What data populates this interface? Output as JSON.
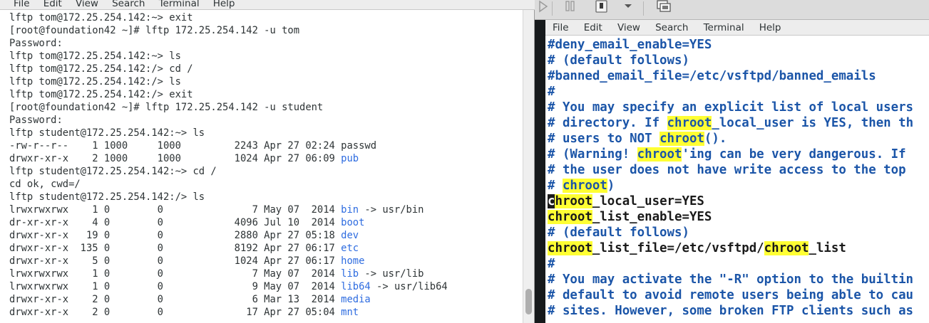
{
  "left_terminal": {
    "menu": [
      "File",
      "Edit",
      "View",
      "Search",
      "Terminal",
      "Help"
    ],
    "lines": [
      {
        "text": "lftp tom@172.25.254.142:~> exit"
      },
      {
        "text": "[root@foundation42 ~]# lftp 172.25.254.142 -u tom"
      },
      {
        "text": "Password:"
      },
      {
        "text": "lftp tom@172.25.254.142:~> ls"
      },
      {
        "text": "lftp tom@172.25.254.142:/> cd /"
      },
      {
        "text": "lftp tom@172.25.254.142:/> ls"
      },
      {
        "text": "lftp tom@172.25.254.142:/> exit"
      },
      {
        "text": "[root@foundation42 ~]# lftp 172.25.254.142 -u student"
      },
      {
        "text": "Password:"
      },
      {
        "text": "lftp student@172.25.254.142:~> ls"
      },
      {
        "meta": "-rw-r--r--    1 1000     1000         2243 Apr 27 02:24 ",
        "name": "passwd",
        "tail": "",
        "dir": false
      },
      {
        "meta": "drwxr-xr-x    2 1000     1000         1024 Apr 27 06:09 ",
        "name": "pub",
        "tail": "",
        "dir": true
      },
      {
        "text": "lftp student@172.25.254.142:~> cd /"
      },
      {
        "text": "cd ok, cwd=/"
      },
      {
        "text": "lftp student@172.25.254.142:/> ls"
      },
      {
        "meta": "lrwxrwxrwx    1 0        0               7 May 07  2014 ",
        "name": "bin",
        "tail": " -> usr/bin",
        "dir": true
      },
      {
        "meta": "dr-xr-xr-x    4 0        0            4096 Jul 10  2014 ",
        "name": "boot",
        "tail": "",
        "dir": true
      },
      {
        "meta": "drwxr-xr-x   19 0        0            2880 Apr 27 05:18 ",
        "name": "dev",
        "tail": "",
        "dir": true
      },
      {
        "meta": "drwxr-xr-x  135 0        0            8192 Apr 27 06:17 ",
        "name": "etc",
        "tail": "",
        "dir": true
      },
      {
        "meta": "drwxr-xr-x    5 0        0            1024 Apr 27 06:17 ",
        "name": "home",
        "tail": "",
        "dir": true
      },
      {
        "meta": "lrwxrwxrwx    1 0        0               7 May 07  2014 ",
        "name": "lib",
        "tail": " -> usr/lib",
        "dir": true
      },
      {
        "meta": "lrwxrwxrwx    1 0        0               9 May 07  2014 ",
        "name": "lib64",
        "tail": " -> usr/lib64",
        "dir": true
      },
      {
        "meta": "drwxr-xr-x    2 0        0               6 Mar 13  2014 ",
        "name": "media",
        "tail": "",
        "dir": true
      },
      {
        "meta": "drwxr-xr-x    2 0        0              17 Apr 27 05:04 ",
        "name": "mnt",
        "tail": "",
        "dir": true
      }
    ]
  },
  "vm_toolbar": {
    "icons": [
      "play-icon",
      "pause-icon",
      "stop-icon",
      "dropdown-arrow-icon",
      "screens-icon"
    ]
  },
  "right_terminal": {
    "menu": [
      "File",
      "Edit",
      "View",
      "Search",
      "Terminal",
      "Help"
    ],
    "lines": [
      {
        "kind": "comment",
        "segments": [
          {
            "t": "#deny_email_enable=YES"
          }
        ]
      },
      {
        "kind": "comment",
        "segments": [
          {
            "t": "# (default follows)"
          }
        ]
      },
      {
        "kind": "comment",
        "segments": [
          {
            "t": "#banned_email_file=/etc/vsftpd/banned_emails"
          }
        ]
      },
      {
        "kind": "comment",
        "segments": [
          {
            "t": "#"
          }
        ]
      },
      {
        "kind": "comment",
        "segments": [
          {
            "t": "# You may specify an explicit list of local users"
          }
        ]
      },
      {
        "kind": "comment",
        "segments": [
          {
            "t": "# directory. If "
          },
          {
            "t": "chroot",
            "hl": true
          },
          {
            "t": "_local_user is YES, then th"
          }
        ]
      },
      {
        "kind": "comment",
        "segments": [
          {
            "t": "# users to NOT "
          },
          {
            "t": "chroot",
            "hl": true
          },
          {
            "t": "()."
          }
        ]
      },
      {
        "kind": "comment",
        "segments": [
          {
            "t": "# (Warning! "
          },
          {
            "t": "chroot",
            "hl": true
          },
          {
            "t": "'ing can be very dangerous. If"
          }
        ]
      },
      {
        "kind": "comment",
        "segments": [
          {
            "t": "# the user does not have write access to the top"
          }
        ]
      },
      {
        "kind": "comment",
        "segments": [
          {
            "t": "# "
          },
          {
            "t": "chroot",
            "hl": true
          },
          {
            "t": ")"
          }
        ]
      },
      {
        "kind": "setting",
        "segments": [
          {
            "t": "c",
            "cursor": true
          },
          {
            "t": "hroot",
            "hl": true
          },
          {
            "t": "_local_user=YES"
          }
        ]
      },
      {
        "kind": "setting",
        "segments": [
          {
            "t": "chroot",
            "hl": true
          },
          {
            "t": "_list_enable=YES"
          }
        ]
      },
      {
        "kind": "comment",
        "segments": [
          {
            "t": "# (default follows)"
          }
        ]
      },
      {
        "kind": "setting",
        "segments": [
          {
            "t": "chroot",
            "hl": true
          },
          {
            "t": "_list_file=/etc/vsftpd/"
          },
          {
            "t": "chroot",
            "hl": true
          },
          {
            "t": "_list"
          }
        ]
      },
      {
        "kind": "comment",
        "segments": [
          {
            "t": "#"
          }
        ]
      },
      {
        "kind": "comment",
        "segments": [
          {
            "t": "# You may activate the \"-R\" option to the builtin"
          }
        ]
      },
      {
        "kind": "comment",
        "segments": [
          {
            "t": "# default to avoid remote users being able to cau"
          }
        ]
      },
      {
        "kind": "comment",
        "segments": [
          {
            "t": "# sites. However, some broken FTP clients such as"
          }
        ]
      }
    ]
  },
  "colors": {
    "dir_blue": "#2e6ce0",
    "comment_blue": "#1b55a8",
    "highlight_yellow": "#ffff33"
  }
}
